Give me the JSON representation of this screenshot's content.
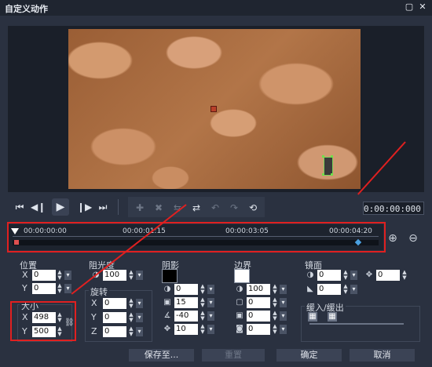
{
  "window": {
    "title": "自定义动作",
    "restore_icon": "▢",
    "close_icon": "✕"
  },
  "transport": {
    "timecode": "0:00:00:000"
  },
  "timeline": {
    "ticks": [
      "00:00:00:00",
      "00:00:01:15",
      "00:00:03:05",
      "00:00:04:20"
    ]
  },
  "position": {
    "label": "位置",
    "x_label": "X",
    "x_value": "0",
    "y_label": "Y",
    "y_value": "0"
  },
  "size": {
    "label": "大小",
    "x_label": "X",
    "x_value": "498",
    "y_label": "Y",
    "y_value": "500"
  },
  "opacity": {
    "label": "阻光度",
    "value": "100"
  },
  "rotation": {
    "label": "旋转",
    "x_label": "X",
    "x_value": "0",
    "y_label": "Y",
    "y_value": "0",
    "z_label": "Z",
    "z_value": "0"
  },
  "shadow": {
    "label": "阴影",
    "v1": "0",
    "v2": "15",
    "v3": "-40",
    "v4": "10",
    "color": "#000000"
  },
  "border": {
    "label": "边界",
    "v1": "100",
    "v2": "0",
    "v3": "0",
    "v4": "0",
    "color": "#ffffff"
  },
  "mirror": {
    "label": "镜面",
    "v1": "0",
    "v2": "0",
    "v3": "0"
  },
  "fade": {
    "label": "缓入/缓出"
  },
  "footer": {
    "save_as": "保存至...",
    "reset": "重置",
    "ok": "确定",
    "cancel": "取消"
  },
  "colors": {
    "highlight": "#e02020",
    "background": "#2a3140"
  }
}
